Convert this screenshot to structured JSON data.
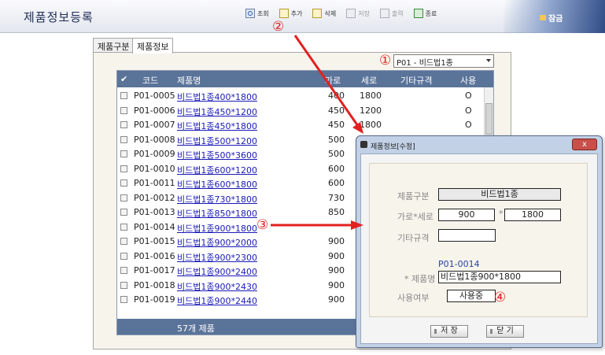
{
  "header": {
    "title": "제품정보등록",
    "toolbar": [
      {
        "label": "조회",
        "icon": "search-icon"
      },
      {
        "label": "추가",
        "icon": "add-icon"
      },
      {
        "label": "삭제",
        "icon": "delete-icon"
      },
      {
        "label": "저장",
        "icon": "save-icon"
      },
      {
        "label": "출력",
        "icon": "print-icon"
      },
      {
        "label": "종료",
        "icon": "exit-icon"
      }
    ],
    "lock_label": "잠금"
  },
  "markers": {
    "m1": "①",
    "m2": "②",
    "m3": "③",
    "m4": "④"
  },
  "tabs": [
    {
      "label": "제품구분"
    },
    {
      "label": "제품정보"
    }
  ],
  "category_select": {
    "value": "P01 - 비드법1종"
  },
  "grid": {
    "columns": [
      "✔",
      "코드",
      "제품명",
      "가로",
      "세로",
      "기타규격",
      "사용"
    ],
    "rows": [
      {
        "code": "P01-0005",
        "name": "비드법1종400*1800",
        "width": "400",
        "height": "1800",
        "use": "O"
      },
      {
        "code": "P01-0006",
        "name": "비드법1종450*1200",
        "width": "450",
        "height": "1200",
        "use": "O"
      },
      {
        "code": "P01-0007",
        "name": "비드법1종450*1800",
        "width": "450",
        "height": "1800",
        "use": "O"
      },
      {
        "code": "P01-0008",
        "name": "비드법1종500*1200",
        "width": "500",
        "height": "1200",
        "use": "O"
      },
      {
        "code": "P01-0009",
        "name": "비드법1종500*3600",
        "width": "500",
        "height": "",
        "use": ""
      },
      {
        "code": "P01-0010",
        "name": "비드법1종600*1200",
        "width": "600",
        "height": "",
        "use": ""
      },
      {
        "code": "P01-0011",
        "name": "비드법1종600*1800",
        "width": "600",
        "height": "",
        "use": ""
      },
      {
        "code": "P01-0012",
        "name": "비드법1종730*1800",
        "width": "730",
        "height": "",
        "use": ""
      },
      {
        "code": "P01-0013",
        "name": "비드법1종850*1800",
        "width": "850",
        "height": "",
        "use": ""
      },
      {
        "code": "P01-0014",
        "name": "비드법1종900*1800",
        "width": "",
        "height": "",
        "use": ""
      },
      {
        "code": "P01-0015",
        "name": "비드법1종900*2000",
        "width": "900",
        "height": "",
        "use": ""
      },
      {
        "code": "P01-0016",
        "name": "비드법1종900*2300",
        "width": "900",
        "height": "",
        "use": ""
      },
      {
        "code": "P01-0017",
        "name": "비드법1종900*2400",
        "width": "900",
        "height": "",
        "use": ""
      },
      {
        "code": "P01-0018",
        "name": "비드법1종900*2430",
        "width": "900",
        "height": "",
        "use": ""
      },
      {
        "code": "P01-0019",
        "name": "비드법1종900*2440",
        "width": "900",
        "height": "",
        "use": ""
      }
    ],
    "footer": "57개 제품"
  },
  "dialog": {
    "title": "제품정보[수정]",
    "close": "x",
    "category_label": "제품구분",
    "category_value": "비드법1종",
    "size_label": "가로*세로",
    "width": "900",
    "separator": "*",
    "height": "1800",
    "etc_label": "기타규격",
    "etc_value": "",
    "code": "P01-0014",
    "name_label": "* 제품명",
    "name_value": "비드법1종900*1800",
    "use_label": "사용여부",
    "use_value": "사용중",
    "save_label": "저  장",
    "close_label": "닫  기"
  },
  "colors": {
    "accent": "#5a7399",
    "annotation": "#e32020",
    "link": "#1a1ab8"
  }
}
